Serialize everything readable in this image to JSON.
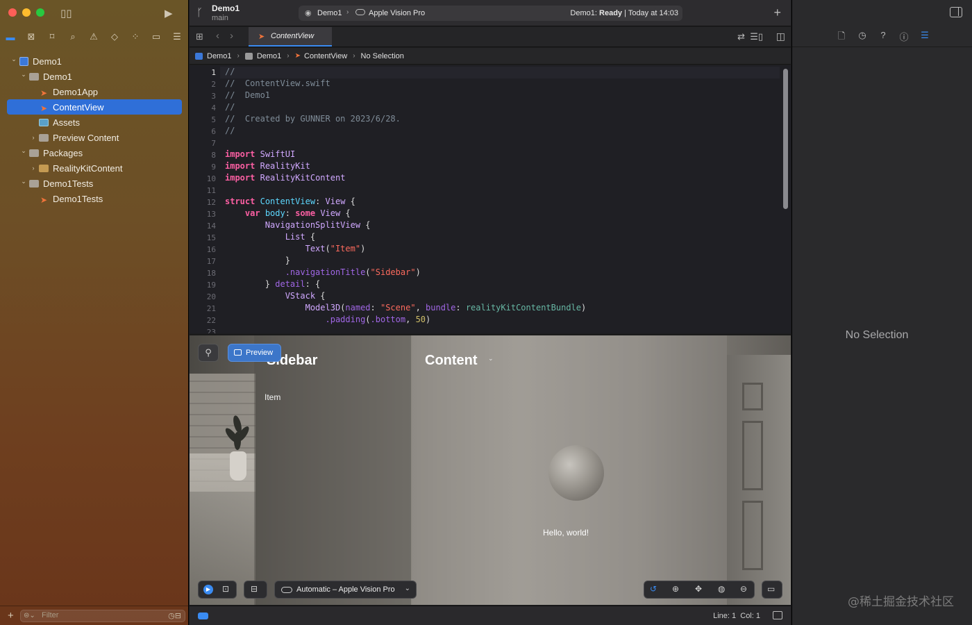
{
  "project": {
    "name": "Demo1",
    "branch": "main"
  },
  "activity": {
    "scheme": "Demo1",
    "device": "Apple Vision Pro",
    "status_prefix": "Demo1:",
    "status_state": "Ready",
    "status_suffix": "| Today at 14:03"
  },
  "navigator": {
    "tree": [
      {
        "label": "Demo1",
        "level": 0,
        "icon": "project-icon",
        "expanded": true
      },
      {
        "label": "Demo1",
        "level": 1,
        "icon": "folder-icon",
        "expanded": true
      },
      {
        "label": "Demo1App",
        "level": 2,
        "icon": "swift-file-icon"
      },
      {
        "label": "ContentView",
        "level": 2,
        "icon": "swift-file-icon",
        "selected": true
      },
      {
        "label": "Assets",
        "level": 2,
        "icon": "asset-catalog-icon"
      },
      {
        "label": "Preview Content",
        "level": 2,
        "icon": "folder-icon",
        "expanded": false
      },
      {
        "label": "Packages",
        "level": 1,
        "icon": "folder-icon",
        "expanded": true
      },
      {
        "label": "RealityKitContent",
        "level": 2,
        "icon": "package-icon",
        "expanded": false
      },
      {
        "label": "Demo1Tests",
        "level": 1,
        "icon": "folder-icon",
        "expanded": true
      },
      {
        "label": "Demo1Tests",
        "level": 2,
        "icon": "swift-file-icon"
      }
    ],
    "filter_placeholder": "Filter"
  },
  "editor": {
    "tab_label": "ContentView",
    "jump_bar": [
      "Demo1",
      "Demo1",
      "ContentView",
      "No Selection"
    ],
    "current_line": 1,
    "code_lines": [
      "//",
      "//  ContentView.swift",
      "//  Demo1",
      "//",
      "//  Created by GUNNER on 2023/6/28.",
      "//",
      "",
      "import SwiftUI",
      "import RealityKit",
      "import RealityKitContent",
      "",
      "struct ContentView: View {",
      "    var body: some View {",
      "        NavigationSplitView {",
      "            List {",
      "                Text(\"Item\")",
      "            }",
      "            .navigationTitle(\"Sidebar\")",
      "        } detail: {",
      "            VStack {",
      "                Model3D(named: \"Scene\", bundle: realityKitContentBundle)",
      "                    .padding(.bottom, 50)",
      ""
    ],
    "line_numbers": [
      "1",
      "2",
      "3",
      "4",
      "5",
      "6",
      "7",
      "8",
      "9",
      "10",
      "11",
      "12",
      "13",
      "14",
      "15",
      "16",
      "17",
      "18",
      "19",
      "20",
      "21",
      "22",
      "23"
    ]
  },
  "preview": {
    "button_label": "Preview",
    "sidebar_title": "Sidebar",
    "sidebar_item": "Item",
    "content_title": "Content",
    "hello_text": "Hello, world!",
    "device_label": "Automatic – Apple Vision Pro"
  },
  "status": {
    "line": "Line: 1",
    "col": "Col: 1"
  },
  "inspector": {
    "empty_label": "No Selection"
  },
  "watermark": "@稀土掘金技术社区",
  "colors": {
    "accent": "#3a8bf2",
    "selection": "#2f6fd8",
    "swift": "#f0743b"
  }
}
